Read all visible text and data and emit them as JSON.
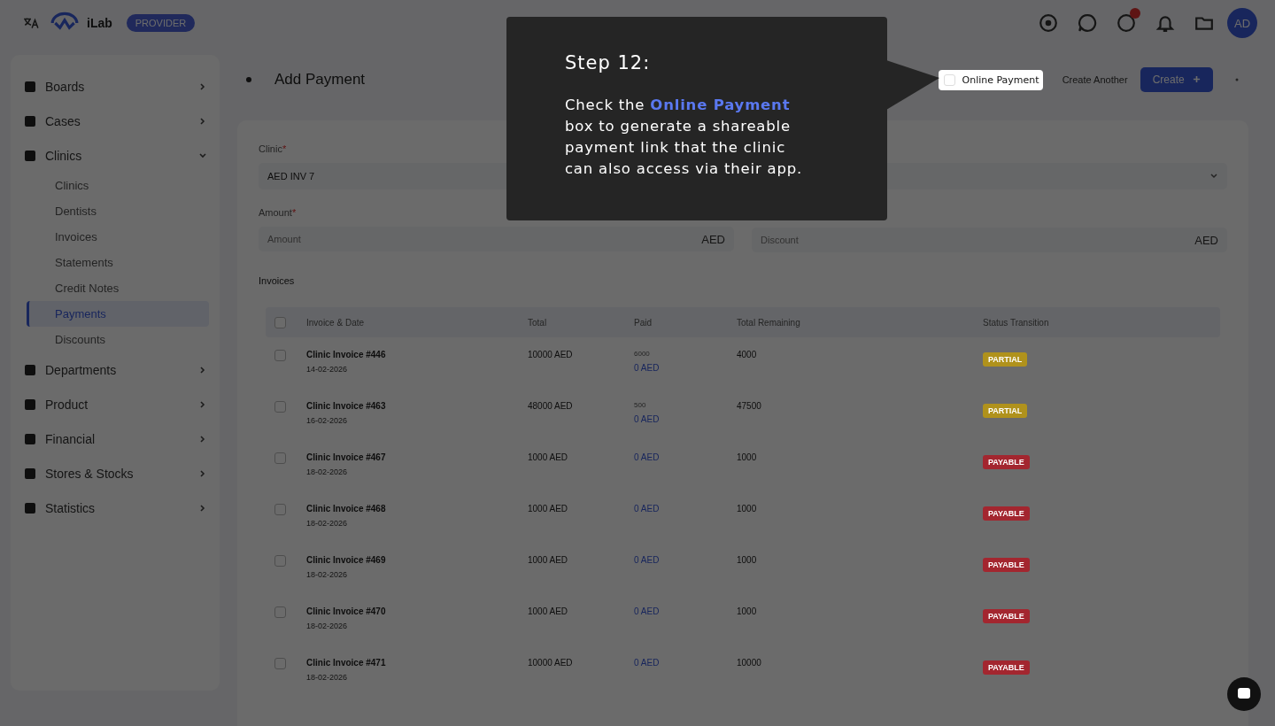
{
  "header": {
    "logo": "iLab",
    "badge": "PROVIDER",
    "avatar": "AD"
  },
  "sidebar": {
    "items": [
      {
        "label": "Boards",
        "expanded": false
      },
      {
        "label": "Cases",
        "expanded": false
      },
      {
        "label": "Clinics",
        "expanded": true,
        "children": [
          {
            "label": "Clinics",
            "selected": false
          },
          {
            "label": "Dentists",
            "selected": false
          },
          {
            "label": "Invoices",
            "selected": false
          },
          {
            "label": "Statements",
            "selected": false
          },
          {
            "label": "Credit Notes",
            "selected": false
          },
          {
            "label": "Payments",
            "selected": true
          },
          {
            "label": "Discounts",
            "selected": false
          }
        ]
      },
      {
        "label": "Departments",
        "expanded": false
      },
      {
        "label": "Product",
        "expanded": false
      },
      {
        "label": "Financial",
        "expanded": false
      },
      {
        "label": "Stores & Stocks",
        "expanded": false
      },
      {
        "label": "Statistics",
        "expanded": false
      }
    ]
  },
  "page": {
    "title": "Add Payment",
    "online_payment": {
      "label": "Online Payment",
      "checked": false
    },
    "create_another": "Create Another",
    "create_button": "Create"
  },
  "form": {
    "fields": [
      {
        "kind": "select",
        "label": "Clinic",
        "marker": "*",
        "value": "AED INV 7"
      },
      {
        "kind": "amount",
        "label": "Amount",
        "marker": "*",
        "placeholder": "Amount",
        "suffix": "AED"
      },
      {
        "kind": "amount",
        "placeholder": "Discount",
        "suffix": "AED"
      }
    ]
  },
  "invoices": {
    "title": "Invoices",
    "all_checked": false,
    "columns": [
      "Invoice & Date",
      "Total",
      "Paid",
      "Total Remaining",
      "Status Transition"
    ],
    "rows": [
      {
        "checked": false,
        "invoice": "Clinic Invoice #446",
        "date": "14-02-2026",
        "total": "10000 AED",
        "paid_note": "6000",
        "paid": "0 AED",
        "remaining": "4000",
        "status": "PARTIAL",
        "color": "#b0921c"
      },
      {
        "checked": false,
        "invoice": "Clinic Invoice #463",
        "date": "16-02-2026",
        "total": "48000 AED",
        "paid_note": "500",
        "paid": "0 AED",
        "remaining": "47500",
        "status": "PARTIAL",
        "color": "#b0921c"
      },
      {
        "checked": false,
        "invoice": "Clinic Invoice #467",
        "date": "18-02-2026",
        "total": "1000 AED",
        "paid": "0 AED",
        "remaining": "1000",
        "status": "PAYABLE",
        "color": "#a3262f"
      },
      {
        "checked": false,
        "invoice": "Clinic Invoice #468",
        "date": "18-02-2026",
        "total": "1000 AED",
        "paid": "0 AED",
        "remaining": "1000",
        "status": "PAYABLE",
        "color": "#a3262f"
      },
      {
        "checked": false,
        "invoice": "Clinic Invoice #469",
        "date": "18-02-2026",
        "total": "1000 AED",
        "paid": "0 AED",
        "remaining": "1000",
        "status": "PAYABLE",
        "color": "#a3262f"
      },
      {
        "checked": false,
        "invoice": "Clinic Invoice #470",
        "date": "18-02-2026",
        "total": "1000 AED",
        "paid": "0 AED",
        "remaining": "1000",
        "status": "PAYABLE",
        "color": "#a3262f"
      },
      {
        "checked": false,
        "invoice": "Clinic Invoice #471",
        "date": "18-02-2026",
        "total": "10000 AED",
        "paid": "0 AED",
        "remaining": "10000",
        "status": "PAYABLE",
        "color": "#a3262f"
      }
    ]
  },
  "tour": {
    "step": "Step 12:",
    "body": "Check the **Online Payment** box to generate a shareable payment link that the clinic can also access via their app."
  }
}
